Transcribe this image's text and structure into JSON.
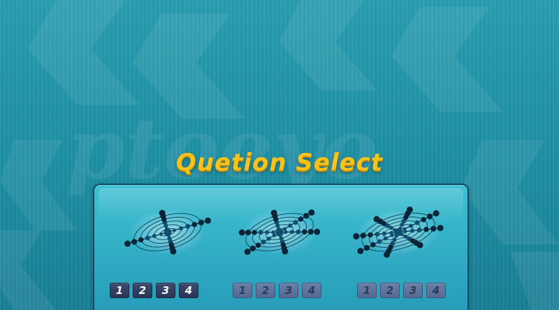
{
  "title": "Quetion Select",
  "webs": [
    {
      "name": "web-1",
      "spokes": 4,
      "levels": [
        {
          "label": "1",
          "enabled": true
        },
        {
          "label": "2",
          "enabled": true
        },
        {
          "label": "3",
          "enabled": true
        },
        {
          "label": "4",
          "enabled": true
        }
      ]
    },
    {
      "name": "web-2",
      "spokes": 6,
      "levels": [
        {
          "label": "1",
          "enabled": false
        },
        {
          "label": "2",
          "enabled": false
        },
        {
          "label": "3",
          "enabled": false
        },
        {
          "label": "4",
          "enabled": false
        }
      ]
    },
    {
      "name": "web-3",
      "spokes": 8,
      "levels": [
        {
          "label": "1",
          "enabled": false
        },
        {
          "label": "2",
          "enabled": false
        },
        {
          "label": "3",
          "enabled": false
        },
        {
          "label": "4",
          "enabled": false
        }
      ]
    }
  ],
  "colors": {
    "background": "#1f8a9e",
    "title": "#f7c21a",
    "node_center": "#0f4e6e",
    "node_outer": "#0b2536",
    "ring": "#0d3d55"
  }
}
